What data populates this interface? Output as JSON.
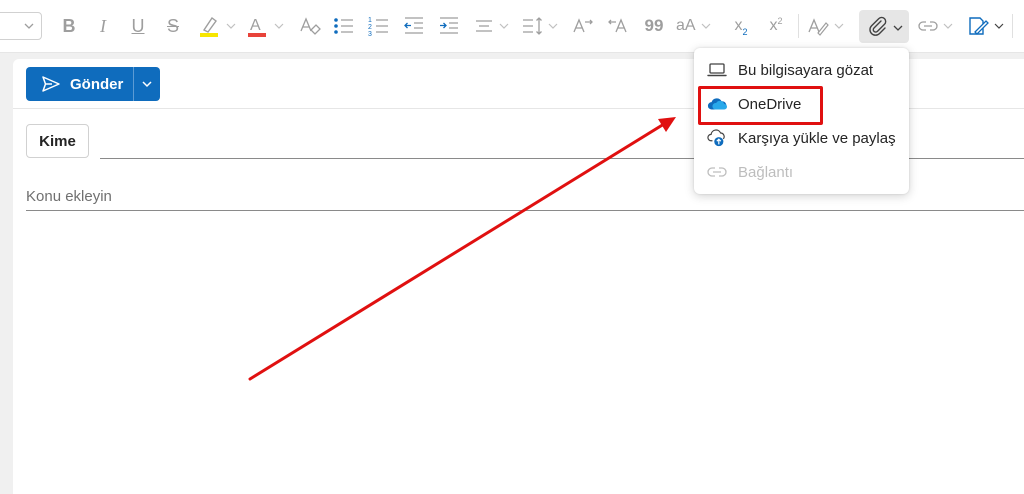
{
  "ribbon": {
    "icons": [
      "font-size-dropdown",
      "bold-icon",
      "italic-icon",
      "underline-icon",
      "strikethrough-icon",
      "highlight-icon",
      "font-color-icon",
      "clear-formatting-icon",
      "bullets-icon",
      "numbering-icon",
      "decrease-indent-icon",
      "increase-indent-icon",
      "align-icon",
      "line-spacing-icon",
      "ltr-icon",
      "rtl-icon",
      "quote-icon",
      "change-case-icon",
      "subscript-icon",
      "superscript-icon",
      "styles-icon",
      "attach-icon",
      "link-icon",
      "signature-icon"
    ],
    "colors": {
      "highlight": "#f7e600",
      "font_color": "#e8433a"
    },
    "bold": "B",
    "italic": "I",
    "underline": "U",
    "strike": "S",
    "font_color": "A",
    "quote": "99",
    "case": "aA",
    "subscript": "x",
    "subscript_sub": "2",
    "superscript": "x",
    "superscript_sup": "2"
  },
  "compose": {
    "send_label": "Gönder",
    "to_label": "Kime",
    "subject_placeholder": "Konu ekleyin"
  },
  "attach_menu": {
    "items": [
      {
        "label": "Bu bilgisayara gözat",
        "icon": "laptop-icon",
        "enabled": true
      },
      {
        "label": "OneDrive",
        "icon": "onedrive-cloud-icon",
        "enabled": true
      },
      {
        "label": "Karşıya yükle ve paylaş",
        "icon": "cloud-upload-icon",
        "enabled": true
      },
      {
        "label": "Bağlantı",
        "icon": "link-icon",
        "enabled": false
      }
    ]
  },
  "annotations": {
    "highlight_color": "#e01010",
    "arrow_color": "#e01010"
  },
  "colors": {
    "accent": "#0f6cbd",
    "onedrive": "#0f6cbd"
  }
}
